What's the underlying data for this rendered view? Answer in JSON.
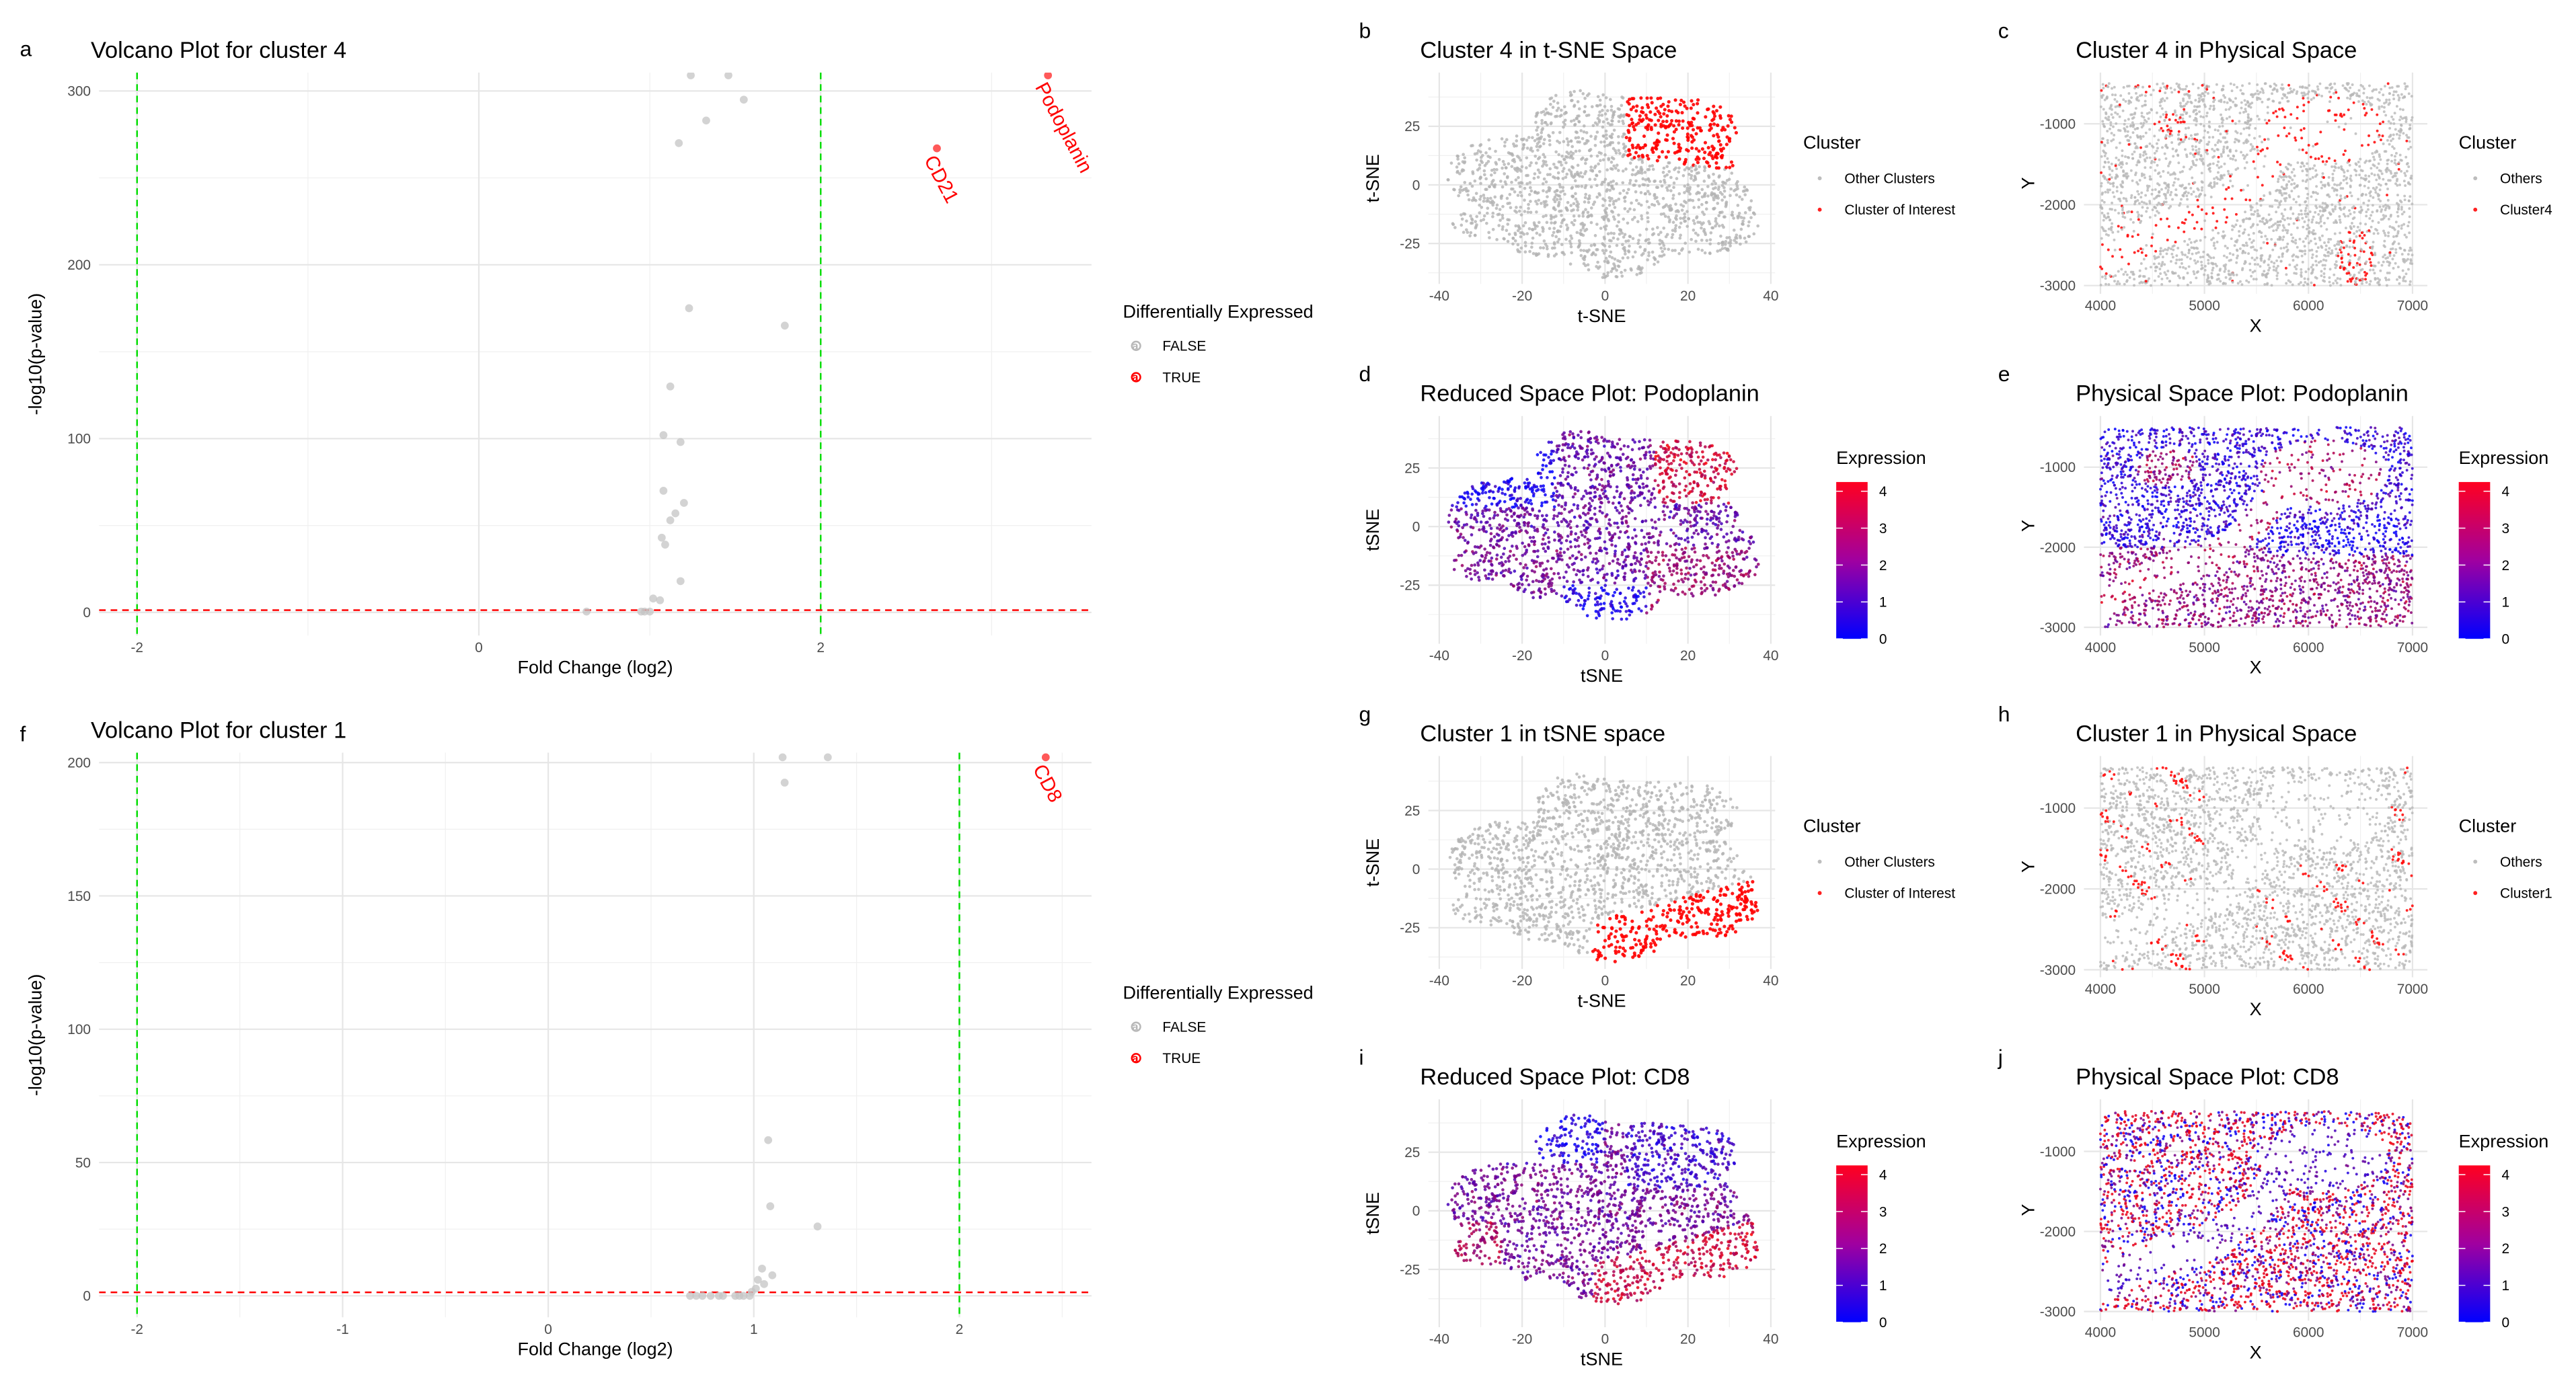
{
  "panel_letters": [
    "a",
    "b",
    "c",
    "d",
    "e",
    "f",
    "g",
    "h",
    "i",
    "j"
  ],
  "colors": {
    "gray_point": "#BEBEBE",
    "red_point": "#FF0000",
    "threshold_fc": "#00DD00",
    "threshold_p": "#FF0000",
    "expr_low": "#0000FF",
    "expr_high": "#FF0000"
  },
  "chart_data": [
    {
      "panel": "a",
      "type": "scatter",
      "title": "Volcano Plot for cluster 4",
      "xlabel": "Fold Change (log2)",
      "ylabel": "-log10(p-value)",
      "xlim": [
        -2.22,
        3.58
      ],
      "ylim": [
        -15,
        310
      ],
      "xticks": [
        -2,
        0,
        2
      ],
      "yticks": [
        0,
        100,
        200,
        300
      ],
      "grid": true,
      "thresholds": {
        "fold_change": [
          -2,
          2
        ],
        "neg_log10_p": 1.3
      },
      "legend": {
        "title": "Differentially Expressed",
        "entries": [
          "FALSE",
          "TRUE"
        ],
        "placement": "right"
      },
      "points": [
        {
          "x": 1.24,
          "y": 309,
          "de": false
        },
        {
          "x": 1.46,
          "y": 309,
          "de": false
        },
        {
          "x": 1.55,
          "y": 295,
          "de": false
        },
        {
          "x": 1.33,
          "y": 283,
          "de": false
        },
        {
          "x": 1.17,
          "y": 270,
          "de": false
        },
        {
          "x": 1.23,
          "y": 175,
          "de": false
        },
        {
          "x": 1.79,
          "y": 165,
          "de": false
        },
        {
          "x": 1.12,
          "y": 130,
          "de": false
        },
        {
          "x": 1.08,
          "y": 102,
          "de": false
        },
        {
          "x": 1.18,
          "y": 98,
          "de": false
        },
        {
          "x": 1.08,
          "y": 70,
          "de": false
        },
        {
          "x": 1.2,
          "y": 63,
          "de": false
        },
        {
          "x": 1.15,
          "y": 57,
          "de": false
        },
        {
          "x": 1.12,
          "y": 53,
          "de": false
        },
        {
          "x": 1.07,
          "y": 43,
          "de": false
        },
        {
          "x": 1.09,
          "y": 39,
          "de": false
        },
        {
          "x": 1.18,
          "y": 18,
          "de": false
        },
        {
          "x": 1.02,
          "y": 8,
          "de": false
        },
        {
          "x": 1.06,
          "y": 7,
          "de": false
        },
        {
          "x": 0.63,
          "y": 0.5,
          "de": false
        },
        {
          "x": 0.95,
          "y": 0.5,
          "de": false
        },
        {
          "x": 0.97,
          "y": 0.5,
          "de": false
        },
        {
          "x": 1.0,
          "y": 0.5,
          "de": false
        },
        {
          "x": 2.68,
          "y": 267,
          "de": true,
          "label": "CD21"
        },
        {
          "x": 3.33,
          "y": 309,
          "de": true,
          "label": "Podoplanin"
        }
      ]
    },
    {
      "panel": "b",
      "type": "scatter",
      "title": "Cluster 4 in t-SNE Space",
      "xlabel": "t-SNE",
      "ylabel": "t-SNE",
      "xlim": [
        -43,
        41
      ],
      "ylim": [
        -45,
        47
      ],
      "xticks": [
        -40,
        -20,
        0,
        20,
        40
      ],
      "yticks": [
        -25,
        0,
        25
      ],
      "grid": true,
      "legend": {
        "title": "Cluster",
        "entries": [
          "Other Clusters",
          "Cluster of Interest"
        ],
        "placement": "right"
      }
    },
    {
      "panel": "c",
      "type": "scatter",
      "title": "Cluster 4 in Physical Space",
      "xlabel": "X",
      "ylabel": "Y",
      "xlim": [
        3850,
        7130
      ],
      "ylim": [
        -3100,
        -400
      ],
      "xticks": [
        4000,
        5000,
        6000,
        7000
      ],
      "yticks": [
        -1000,
        -2000,
        -3000
      ],
      "grid": true,
      "legend": {
        "title": "Cluster",
        "entries": [
          "Others",
          "Cluster4"
        ],
        "placement": "right"
      }
    },
    {
      "panel": "d",
      "type": "scatter",
      "title": "Reduced Space Plot: Podoplanin",
      "xlabel": "tSNE",
      "ylabel": "tSNE",
      "xlim": [
        -43,
        41
      ],
      "ylim": [
        -45,
        47
      ],
      "xticks": [
        -40,
        -20,
        0,
        20,
        40
      ],
      "yticks": [
        -25,
        0,
        25
      ],
      "grid": true,
      "legend": {
        "title": "Expression",
        "type": "colorbar",
        "ticks": [
          0,
          1,
          2,
          3,
          4
        ],
        "range": [
          0,
          4.25
        ],
        "placement": "right"
      }
    },
    {
      "panel": "e",
      "type": "scatter",
      "title": "Physical Space Plot: Podoplanin",
      "xlabel": "X",
      "ylabel": "Y",
      "xlim": [
        3850,
        7130
      ],
      "ylim": [
        -3100,
        -400
      ],
      "xticks": [
        4000,
        5000,
        6000,
        7000
      ],
      "yticks": [
        -1000,
        -2000,
        -3000
      ],
      "grid": true,
      "legend": {
        "title": "Expression",
        "type": "colorbar",
        "ticks": [
          0,
          1,
          2,
          3,
          4
        ],
        "range": [
          0,
          4.25
        ],
        "placement": "right"
      }
    },
    {
      "panel": "f",
      "type": "scatter",
      "title": "Volcano Plot for cluster 1",
      "xlabel": "Fold Change (log2)",
      "ylabel": "-log10(p-value)",
      "xlim": [
        -2.22,
        2.65
      ],
      "ylim": [
        -9,
        202
      ],
      "xticks": [
        -2,
        -1,
        0,
        1,
        2
      ],
      "yticks": [
        0,
        50,
        100,
        150,
        200
      ],
      "grid": true,
      "thresholds": {
        "fold_change": [
          -2,
          2
        ],
        "neg_log10_p": 1.3
      },
      "legend": {
        "title": "Differentially Expressed",
        "entries": [
          "FALSE",
          "TRUE"
        ],
        "placement": "right"
      },
      "points": [
        {
          "x": 1.14,
          "y": 202,
          "de": false
        },
        {
          "x": 1.36,
          "y": 202,
          "de": false
        },
        {
          "x": 1.15,
          "y": 192.5,
          "de": false
        },
        {
          "x": 1.07,
          "y": 58.4,
          "de": false
        },
        {
          "x": 1.08,
          "y": 33.6,
          "de": false
        },
        {
          "x": 1.31,
          "y": 26,
          "de": false
        },
        {
          "x": 1.04,
          "y": 10.2,
          "de": false
        },
        {
          "x": 1.09,
          "y": 7.7,
          "de": false
        },
        {
          "x": 1.02,
          "y": 6,
          "de": false
        },
        {
          "x": 1.05,
          "y": 4.4,
          "de": false
        },
        {
          "x": 1.01,
          "y": 2.7,
          "de": false
        },
        {
          "x": 0.99,
          "y": 1.5,
          "de": false
        },
        {
          "x": 0.69,
          "y": 0,
          "de": false
        },
        {
          "x": 0.72,
          "y": 0,
          "de": false
        },
        {
          "x": 0.75,
          "y": 0,
          "de": false
        },
        {
          "x": 0.79,
          "y": 0,
          "de": false
        },
        {
          "x": 0.83,
          "y": 0,
          "de": false
        },
        {
          "x": 0.85,
          "y": 0,
          "de": false
        },
        {
          "x": 0.91,
          "y": 0,
          "de": false
        },
        {
          "x": 0.93,
          "y": 0,
          "de": false
        },
        {
          "x": 0.95,
          "y": 0,
          "de": false
        },
        {
          "x": 0.98,
          "y": 0,
          "de": false
        },
        {
          "x": 2.42,
          "y": 202,
          "de": true,
          "label": "CD8"
        }
      ]
    },
    {
      "panel": "g",
      "type": "scatter",
      "title": "Cluster 1 in tSNE space",
      "xlabel": "t-SNE",
      "ylabel": "t-SNE",
      "xlim": [
        -43,
        41
      ],
      "ylim": [
        -45,
        47
      ],
      "xticks": [
        -40,
        -20,
        0,
        20,
        40
      ],
      "yticks": [
        -25,
        0,
        25
      ],
      "grid": true,
      "legend": {
        "title": "Cluster",
        "entries": [
          "Other Clusters",
          "Cluster of Interest"
        ],
        "placement": "right"
      }
    },
    {
      "panel": "h",
      "type": "scatter",
      "title": "Cluster 1 in Physical Space",
      "xlabel": "X",
      "ylabel": "Y",
      "xlim": [
        3850,
        7130
      ],
      "ylim": [
        -3100,
        -400
      ],
      "xticks": [
        4000,
        5000,
        6000,
        7000
      ],
      "yticks": [
        -1000,
        -2000,
        -3000
      ],
      "grid": true,
      "legend": {
        "title": "Cluster",
        "entries": [
          "Others",
          "Cluster1"
        ],
        "placement": "right"
      }
    },
    {
      "panel": "i",
      "type": "scatter",
      "title": "Reduced Space Plot: CD8",
      "xlabel": "tSNE",
      "ylabel": "tSNE",
      "xlim": [
        -43,
        41
      ],
      "ylim": [
        -45,
        47
      ],
      "xticks": [
        -40,
        -20,
        0,
        20,
        40
      ],
      "yticks": [
        -25,
        0,
        25
      ],
      "grid": true,
      "legend": {
        "title": "Expression",
        "type": "colorbar",
        "ticks": [
          0,
          1,
          2,
          3,
          4
        ],
        "range": [
          0,
          4.25
        ],
        "placement": "right"
      }
    },
    {
      "panel": "j",
      "type": "scatter",
      "title": "Physical Space Plot: CD8",
      "xlabel": "X",
      "ylabel": "Y",
      "xlim": [
        3850,
        7130
      ],
      "ylim": [
        -3100,
        -400
      ],
      "xticks": [
        4000,
        5000,
        6000,
        7000
      ],
      "yticks": [
        -1000,
        -2000,
        -3000
      ],
      "grid": true,
      "legend": {
        "title": "Expression",
        "type": "colorbar",
        "ticks": [
          0,
          1,
          2,
          3,
          4
        ],
        "range": [
          0,
          4.25
        ],
        "placement": "right"
      }
    }
  ]
}
